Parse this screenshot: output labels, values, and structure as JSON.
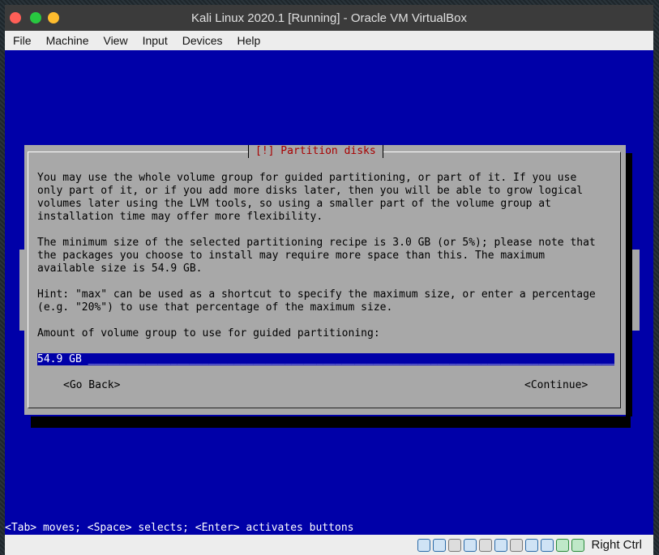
{
  "window": {
    "title": "Kali Linux 2020.1 [Running] - Oracle VM VirtualBox"
  },
  "menubar": {
    "items": [
      "File",
      "Machine",
      "View",
      "Input",
      "Devices",
      "Help"
    ]
  },
  "dialog": {
    "title": "[!] Partition disks",
    "paragraph1": "You may use the whole volume group for guided partitioning, or part of it. If you use\nonly part of it, or if you add more disks later, then you will be able to grow logical\nvolumes later using the LVM tools, so using a smaller part of the volume group at\ninstallation time may offer more flexibility.",
    "paragraph2": "The minimum size of the selected partitioning recipe is 3.0 GB (or 5%); please note that\nthe packages you choose to install may require more space than this. The maximum\navailable size is 54.9 GB.",
    "paragraph3": "Hint: \"max\" can be used as a shortcut to specify the maximum size, or enter a percentage\n(e.g. \"20%\") to use that percentage of the maximum size.",
    "prompt": "Amount of volume group to use for guided partitioning:",
    "input_value": "54.9 GB",
    "go_back_label": "<Go Back>",
    "continue_label": "<Continue>"
  },
  "hint_bar": "<Tab> moves; <Space> selects; <Enter> activates buttons",
  "statusbar": {
    "host_key": "Right Ctrl",
    "icons": [
      "hard-disk-icon",
      "optical-drive-icon",
      "audio-icon",
      "network-icon",
      "usb-icon",
      "shared-folders-icon",
      "display-icon",
      "recording-icon",
      "processor-icon",
      "mouse-integration-icon",
      "host-key-icon"
    ]
  }
}
